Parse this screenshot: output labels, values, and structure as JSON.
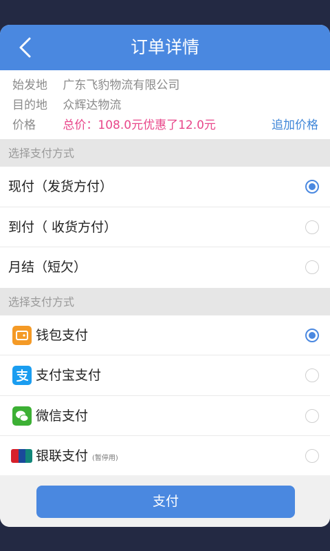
{
  "header": {
    "title": "订单详情",
    "back_icon": "chevron-left-icon"
  },
  "order": {
    "origin_label": "始发地",
    "origin_value": "广东飞豹物流有限公司",
    "dest_label": "目的地",
    "dest_value": "众辉达物流",
    "price_label": "价格",
    "price_value": "总价：108.0元优惠了12.0元",
    "add_price_link": "追加价格"
  },
  "payment_term_section": {
    "label": "选择支付方式",
    "options": [
      {
        "label": "现付（发货方付）",
        "selected": true
      },
      {
        "label": "到付（ 收货方付）",
        "selected": false
      },
      {
        "label": "月结（短欠）",
        "selected": false
      }
    ]
  },
  "payment_method_section": {
    "label": "选择支付方式",
    "options": [
      {
        "label": "钱包支付",
        "icon": "wallet-icon",
        "selected": true,
        "note": ""
      },
      {
        "label": "支付宝支付",
        "icon": "alipay-icon",
        "selected": false,
        "note": ""
      },
      {
        "label": "微信支付",
        "icon": "wechat-icon",
        "selected": false,
        "note": ""
      },
      {
        "label": "银联支付",
        "icon": "unionpay-icon",
        "selected": false,
        "note": "(暂停用)"
      }
    ]
  },
  "footer": {
    "pay_button": "支付"
  },
  "colors": {
    "primary": "#4a88e0",
    "price": "#e8468a",
    "link": "#3f86d8",
    "background": "#232943"
  }
}
